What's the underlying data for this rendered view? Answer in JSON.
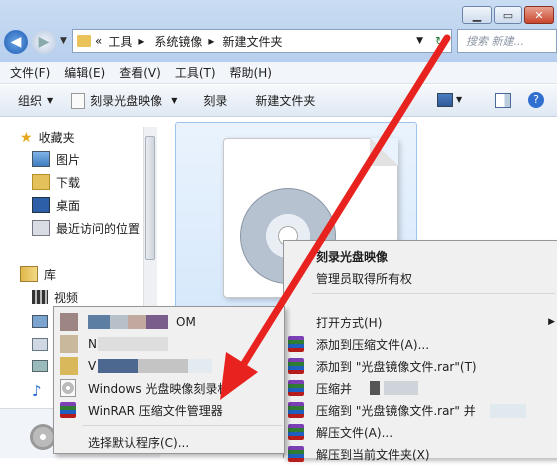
{
  "window": {
    "minimize_icon": "minimize-icon",
    "maximize_icon": "maximize-icon",
    "close_icon": "close-icon"
  },
  "address_bar": {
    "overflow": "«",
    "crumbs": [
      "工具",
      "系统镜像",
      "新建文件夹"
    ]
  },
  "search": {
    "placeholder": "搜索 新建..."
  },
  "menubar": [
    "文件(F)",
    "编辑(E)",
    "查看(V)",
    "工具(T)",
    "帮助(H)"
  ],
  "toolbar": {
    "organize": "组织",
    "burn_image": "刻录光盘映像",
    "burn": "刻录",
    "new_folder": "新建文件夹"
  },
  "sidebar": {
    "favorites": "收藏夹",
    "favorites_items": [
      "图片",
      "下载",
      "桌面",
      "最近访问的位置"
    ],
    "libraries": "库",
    "libraries_items": [
      "视频"
    ]
  },
  "context_menu": {
    "burn_image": "刻录光盘映像",
    "take_ownership": "管理员取得所有权",
    "open_with": "打开方式(H)",
    "add_to_archive": "添加到压缩文件(A)...",
    "add_to_rar": "添加到 \"光盘镜像文件.rar\"(T)",
    "compress_and": "压缩并",
    "compress_to_rar": "压缩到 \"光盘镜像文件.rar\" 并",
    "extract": "解压文件(A)...",
    "extract_here": "解压到当前文件夹(X)"
  },
  "open_with_menu": {
    "item1_suffix": "OM",
    "item2_prefix": "N",
    "item3_prefix": "V",
    "windows_burner": "Windows 光盘映像刻录机",
    "winrar": "WinRAR 压缩文件管理器",
    "choose_default": "选择默认程序(C)..."
  },
  "colors": {
    "arrow": "#e8231f",
    "selection": "#cde4fa"
  }
}
